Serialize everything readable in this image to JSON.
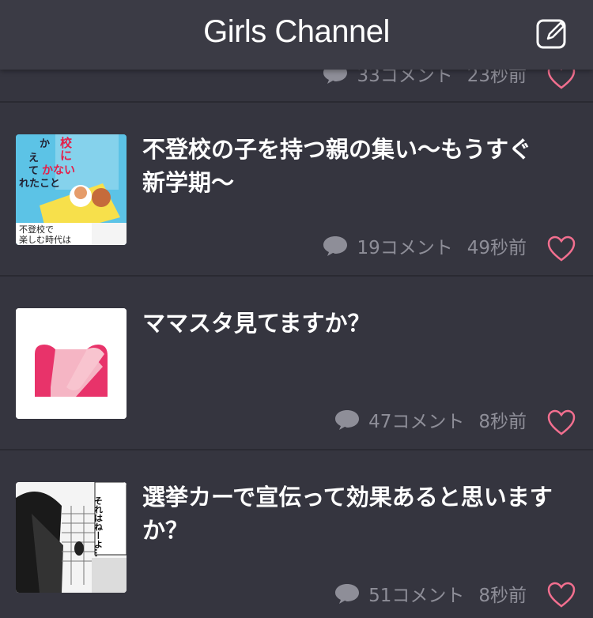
{
  "header": {
    "title": "Girls Channel",
    "compose_icon": "compose-icon"
  },
  "partial_item": {
    "comments": "33コメント",
    "time": "23秒前"
  },
  "items": [
    {
      "title": "不登校の子を持つ親の集い〜もうすぐ新学期〜",
      "comments": "19コメント",
      "time": "49秒前",
      "thumb_text": {
        "l1": "校",
        "l2": "に",
        "l3": "かない",
        "l4": "か",
        "l5": "え",
        "l6": "て",
        "l7": "れたこと",
        "l8": "不登校で",
        "l9": "楽しむ時代は"
      }
    },
    {
      "title": "ママスタ見てますか？",
      "comments": "47コメント",
      "time": "8秒前"
    },
    {
      "title": "選挙カーで宣伝って効果あると思いますか？",
      "comments": "51コメント",
      "time": "8秒前",
      "thumb_text": {
        "bubble": "それはねーよ…"
      }
    }
  ],
  "colors": {
    "accent": "#f26f8f",
    "background": "#35353f",
    "header": "#3b3b45"
  }
}
